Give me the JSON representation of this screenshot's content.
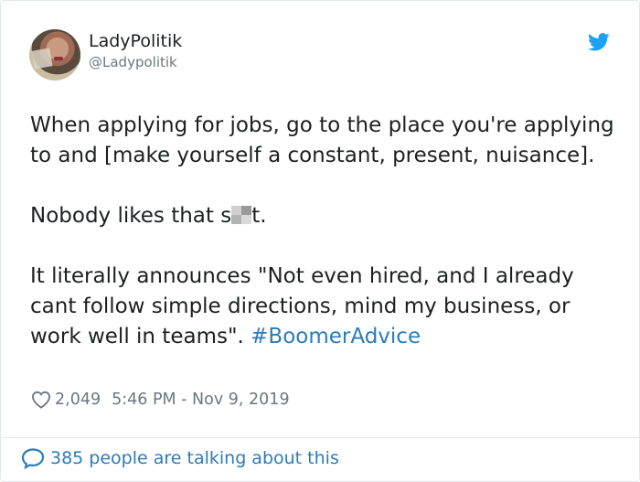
{
  "author": {
    "display_name": "LadyPolitik",
    "handle": "@Ladypolitik",
    "avatar_icon": "profile-photo",
    "brand_icon": "twitter-bird-icon"
  },
  "tweet": {
    "paragraph1": "When applying for jobs, go to the place you're applying to and [make yourself a constant, present, nuisance].",
    "paragraph2_start": "Nobody likes that s",
    "paragraph2_end": "t.",
    "paragraph3": "It literally announces \"Not even hired, and I already cant follow simple directions, mind my business, or work well in teams\". ",
    "hashtag": "#BoomerAdvice"
  },
  "meta": {
    "likes": "2,049",
    "timestamp": "5:46 PM - Nov 9, 2019"
  },
  "footer": {
    "talking_text": "385 people are talking about this"
  },
  "colors": {
    "link": "#2b7bb9",
    "brand": "#1da1f2",
    "muted": "#697882",
    "text": "#1c2022",
    "border": "#e1e8ed"
  }
}
